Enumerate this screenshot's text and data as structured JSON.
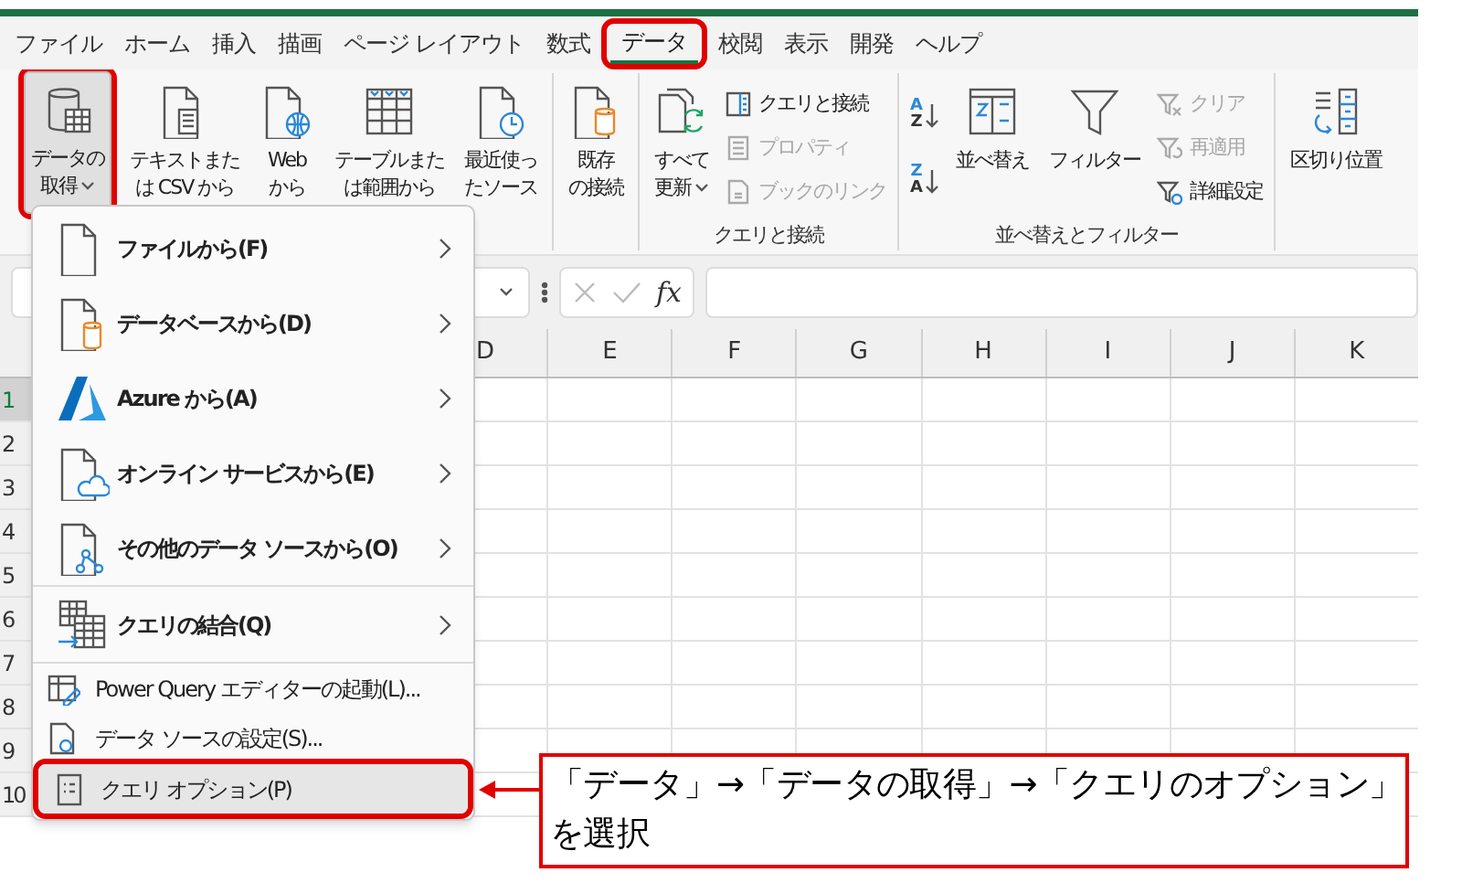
{
  "tabs": [
    {
      "label": "ファイル",
      "selected": false,
      "marked": false
    },
    {
      "label": "ホーム",
      "selected": false,
      "marked": false
    },
    {
      "label": "挿入",
      "selected": false,
      "marked": false
    },
    {
      "label": "描画",
      "selected": false,
      "marked": false
    },
    {
      "label": "ページ レイアウト",
      "selected": false,
      "marked": false
    },
    {
      "label": "数式",
      "selected": false,
      "marked": false
    },
    {
      "label": "データ",
      "selected": true,
      "marked": true
    },
    {
      "label": "校閲",
      "selected": false,
      "marked": false
    },
    {
      "label": "表示",
      "selected": false,
      "marked": false
    },
    {
      "label": "開発",
      "selected": false,
      "marked": false
    },
    {
      "label": "ヘルプ",
      "selected": false,
      "marked": false
    }
  ],
  "ribbon": [
    {
      "items": [
        {
          "kind": "large",
          "lines": [
            "データの",
            "取得"
          ],
          "dropdown": true,
          "pressed": true,
          "marked": true
        },
        {
          "kind": "large",
          "lines": [
            "テキストまた",
            "は CSV から"
          ],
          "dropdown": false,
          "pressed": false,
          "marked": false
        },
        {
          "kind": "large",
          "lines": [
            "Web",
            "から"
          ],
          "dropdown": false,
          "pressed": false,
          "marked": false
        },
        {
          "kind": "large",
          "lines": [
            "テーブルまた",
            "は範囲から"
          ],
          "dropdown": false,
          "pressed": false,
          "marked": false
        },
        {
          "kind": "large",
          "lines": [
            "最近使っ",
            "たソース"
          ],
          "dropdown": false,
          "pressed": false,
          "marked": false
        }
      ]
    },
    {
      "items": [
        {
          "kind": "large",
          "lines": [
            "既存",
            "の接続"
          ],
          "dropdown": false,
          "pressed": false,
          "marked": false
        }
      ]
    },
    {
      "label": "クエリと接続",
      "items": [
        {
          "kind": "large",
          "lines": [
            "すべて",
            "更新"
          ],
          "dropdown": true,
          "pressed": false,
          "marked": false
        },
        {
          "kind": "small",
          "label": "クエリと接続",
          "disabled": false
        },
        {
          "kind": "small",
          "label": "プロパティ",
          "disabled": true
        },
        {
          "kind": "small",
          "label": "ブックのリンク",
          "disabled": true
        }
      ]
    },
    {
      "label": "並べ替えとフィルター",
      "items": [
        {
          "kind": "sort",
          "letters": [
            "A",
            "Z"
          ]
        },
        {
          "kind": "sort",
          "letters": [
            "Z",
            "A"
          ]
        },
        {
          "kind": "large",
          "lines": [
            "並べ替え"
          ],
          "dropdown": false,
          "pressed": false,
          "marked": false
        },
        {
          "kind": "large",
          "lines": [
            "フィルター"
          ],
          "dropdown": false,
          "pressed": false,
          "marked": false
        },
        {
          "kind": "small",
          "label": "クリア",
          "disabled": true
        },
        {
          "kind": "small",
          "label": "再適用",
          "disabled": true
        },
        {
          "kind": "small",
          "label": "詳細設定",
          "disabled": false
        }
      ]
    },
    {
      "items": [
        {
          "kind": "large",
          "lines": [
            "区切り位置"
          ],
          "dropdown": false,
          "pressed": false,
          "marked": false
        }
      ]
    }
  ],
  "formula_bar": {
    "function_symbol": "fx"
  },
  "columns": [
    "D",
    "E",
    "F",
    "G",
    "H",
    "I",
    "J",
    "K"
  ],
  "rows": [
    {
      "label": "1",
      "selected": true
    },
    {
      "label": "2",
      "selected": false
    },
    {
      "label": "3",
      "selected": false
    },
    {
      "label": "4",
      "selected": false
    },
    {
      "label": "5",
      "selected": false
    },
    {
      "label": "6",
      "selected": false
    },
    {
      "label": "7",
      "selected": false
    },
    {
      "label": "8",
      "selected": false
    },
    {
      "label": "9",
      "selected": false
    },
    {
      "label": "10",
      "selected": false
    }
  ],
  "menu": {
    "sections": [
      [
        {
          "kind": "large",
          "label": "ファイルから(F)",
          "submenu": true,
          "selected": false,
          "marked": false
        },
        {
          "kind": "large",
          "label": "データベースから(D)",
          "submenu": true,
          "selected": false,
          "marked": false
        },
        {
          "kind": "large",
          "label": "Azure から(A)",
          "submenu": true,
          "selected": false,
          "marked": false
        },
        {
          "kind": "large",
          "label": "オンライン サービスから(E)",
          "submenu": true,
          "selected": false,
          "marked": false
        },
        {
          "kind": "large",
          "label": "その他のデータ ソースから(O)",
          "submenu": true,
          "selected": false,
          "marked": false
        }
      ],
      [
        {
          "kind": "large",
          "label": "クエリの結合(Q)",
          "submenu": true,
          "selected": false,
          "marked": false
        }
      ],
      [
        {
          "kind": "small",
          "label": "Power Query エディターの起動(L)...",
          "submenu": false,
          "selected": false,
          "marked": false
        },
        {
          "kind": "small",
          "label": "データ ソースの設定(S)...",
          "submenu": false,
          "selected": false,
          "marked": false
        },
        {
          "kind": "small",
          "label": "クエリ オプション(P)",
          "submenu": false,
          "selected": true,
          "marked": true
        }
      ]
    ]
  },
  "callout": {
    "lines": [
      "「データ」→「データの取得」→「クエリのオプション」",
      "を選択"
    ]
  }
}
